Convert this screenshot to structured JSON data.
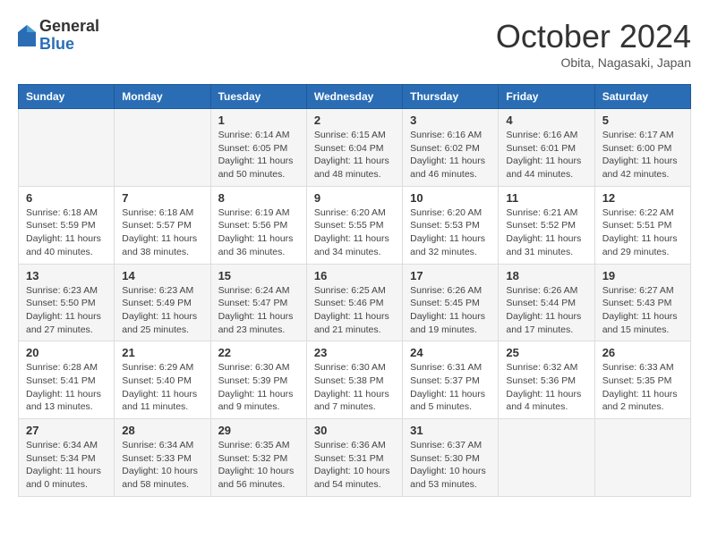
{
  "header": {
    "logo_general": "General",
    "logo_blue": "Blue",
    "month_title": "October 2024",
    "location": "Obita, Nagasaki, Japan"
  },
  "days_of_week": [
    "Sunday",
    "Monday",
    "Tuesday",
    "Wednesday",
    "Thursday",
    "Friday",
    "Saturday"
  ],
  "weeks": [
    [
      {
        "day": "",
        "info": ""
      },
      {
        "day": "",
        "info": ""
      },
      {
        "day": "1",
        "info": "Sunrise: 6:14 AM\nSunset: 6:05 PM\nDaylight: 11 hours and 50 minutes."
      },
      {
        "day": "2",
        "info": "Sunrise: 6:15 AM\nSunset: 6:04 PM\nDaylight: 11 hours and 48 minutes."
      },
      {
        "day": "3",
        "info": "Sunrise: 6:16 AM\nSunset: 6:02 PM\nDaylight: 11 hours and 46 minutes."
      },
      {
        "day": "4",
        "info": "Sunrise: 6:16 AM\nSunset: 6:01 PM\nDaylight: 11 hours and 44 minutes."
      },
      {
        "day": "5",
        "info": "Sunrise: 6:17 AM\nSunset: 6:00 PM\nDaylight: 11 hours and 42 minutes."
      }
    ],
    [
      {
        "day": "6",
        "info": "Sunrise: 6:18 AM\nSunset: 5:59 PM\nDaylight: 11 hours and 40 minutes."
      },
      {
        "day": "7",
        "info": "Sunrise: 6:18 AM\nSunset: 5:57 PM\nDaylight: 11 hours and 38 minutes."
      },
      {
        "day": "8",
        "info": "Sunrise: 6:19 AM\nSunset: 5:56 PM\nDaylight: 11 hours and 36 minutes."
      },
      {
        "day": "9",
        "info": "Sunrise: 6:20 AM\nSunset: 5:55 PM\nDaylight: 11 hours and 34 minutes."
      },
      {
        "day": "10",
        "info": "Sunrise: 6:20 AM\nSunset: 5:53 PM\nDaylight: 11 hours and 32 minutes."
      },
      {
        "day": "11",
        "info": "Sunrise: 6:21 AM\nSunset: 5:52 PM\nDaylight: 11 hours and 31 minutes."
      },
      {
        "day": "12",
        "info": "Sunrise: 6:22 AM\nSunset: 5:51 PM\nDaylight: 11 hours and 29 minutes."
      }
    ],
    [
      {
        "day": "13",
        "info": "Sunrise: 6:23 AM\nSunset: 5:50 PM\nDaylight: 11 hours and 27 minutes."
      },
      {
        "day": "14",
        "info": "Sunrise: 6:23 AM\nSunset: 5:49 PM\nDaylight: 11 hours and 25 minutes."
      },
      {
        "day": "15",
        "info": "Sunrise: 6:24 AM\nSunset: 5:47 PM\nDaylight: 11 hours and 23 minutes."
      },
      {
        "day": "16",
        "info": "Sunrise: 6:25 AM\nSunset: 5:46 PM\nDaylight: 11 hours and 21 minutes."
      },
      {
        "day": "17",
        "info": "Sunrise: 6:26 AM\nSunset: 5:45 PM\nDaylight: 11 hours and 19 minutes."
      },
      {
        "day": "18",
        "info": "Sunrise: 6:26 AM\nSunset: 5:44 PM\nDaylight: 11 hours and 17 minutes."
      },
      {
        "day": "19",
        "info": "Sunrise: 6:27 AM\nSunset: 5:43 PM\nDaylight: 11 hours and 15 minutes."
      }
    ],
    [
      {
        "day": "20",
        "info": "Sunrise: 6:28 AM\nSunset: 5:41 PM\nDaylight: 11 hours and 13 minutes."
      },
      {
        "day": "21",
        "info": "Sunrise: 6:29 AM\nSunset: 5:40 PM\nDaylight: 11 hours and 11 minutes."
      },
      {
        "day": "22",
        "info": "Sunrise: 6:30 AM\nSunset: 5:39 PM\nDaylight: 11 hours and 9 minutes."
      },
      {
        "day": "23",
        "info": "Sunrise: 6:30 AM\nSunset: 5:38 PM\nDaylight: 11 hours and 7 minutes."
      },
      {
        "day": "24",
        "info": "Sunrise: 6:31 AM\nSunset: 5:37 PM\nDaylight: 11 hours and 5 minutes."
      },
      {
        "day": "25",
        "info": "Sunrise: 6:32 AM\nSunset: 5:36 PM\nDaylight: 11 hours and 4 minutes."
      },
      {
        "day": "26",
        "info": "Sunrise: 6:33 AM\nSunset: 5:35 PM\nDaylight: 11 hours and 2 minutes."
      }
    ],
    [
      {
        "day": "27",
        "info": "Sunrise: 6:34 AM\nSunset: 5:34 PM\nDaylight: 11 hours and 0 minutes."
      },
      {
        "day": "28",
        "info": "Sunrise: 6:34 AM\nSunset: 5:33 PM\nDaylight: 10 hours and 58 minutes."
      },
      {
        "day": "29",
        "info": "Sunrise: 6:35 AM\nSunset: 5:32 PM\nDaylight: 10 hours and 56 minutes."
      },
      {
        "day": "30",
        "info": "Sunrise: 6:36 AM\nSunset: 5:31 PM\nDaylight: 10 hours and 54 minutes."
      },
      {
        "day": "31",
        "info": "Sunrise: 6:37 AM\nSunset: 5:30 PM\nDaylight: 10 hours and 53 minutes."
      },
      {
        "day": "",
        "info": ""
      },
      {
        "day": "",
        "info": ""
      }
    ]
  ]
}
